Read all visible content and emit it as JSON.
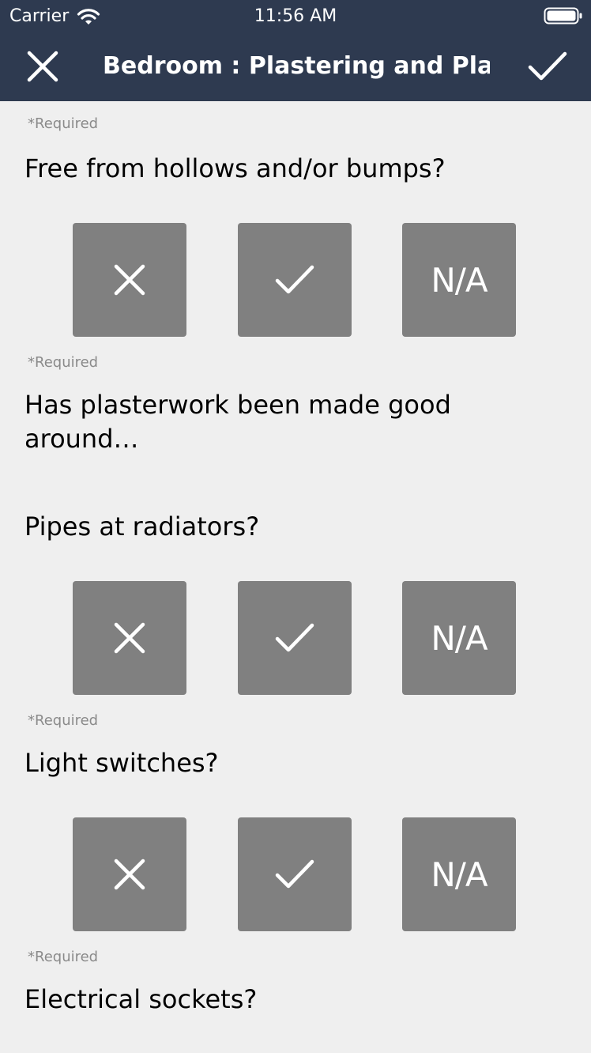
{
  "status_bar": {
    "carrier": "Carrier",
    "time": "11:56 AM"
  },
  "nav": {
    "title": "Bedroom : Plastering and Pla…"
  },
  "required_label": "*Required",
  "top_partial_required": "*Required",
  "questions": [
    {
      "text": "Free from hollows and/or bumps?",
      "required": "*Required",
      "na": "N/A"
    },
    {
      "text": "Has plasterwork been made good around…"
    },
    {
      "text": "Pipes at radiators?",
      "required": "*Required",
      "na": "N/A"
    },
    {
      "text": "Light switches?",
      "required": "*Required",
      "na": "N/A"
    },
    {
      "text": "Electrical sockets?"
    }
  ],
  "colors": {
    "header_bg": "#2e3a50",
    "page_bg": "#efefef",
    "button_bg": "#808080",
    "required_text": "#8a8a8a"
  },
  "icons": {
    "fail": "close-icon",
    "pass": "check-icon"
  }
}
